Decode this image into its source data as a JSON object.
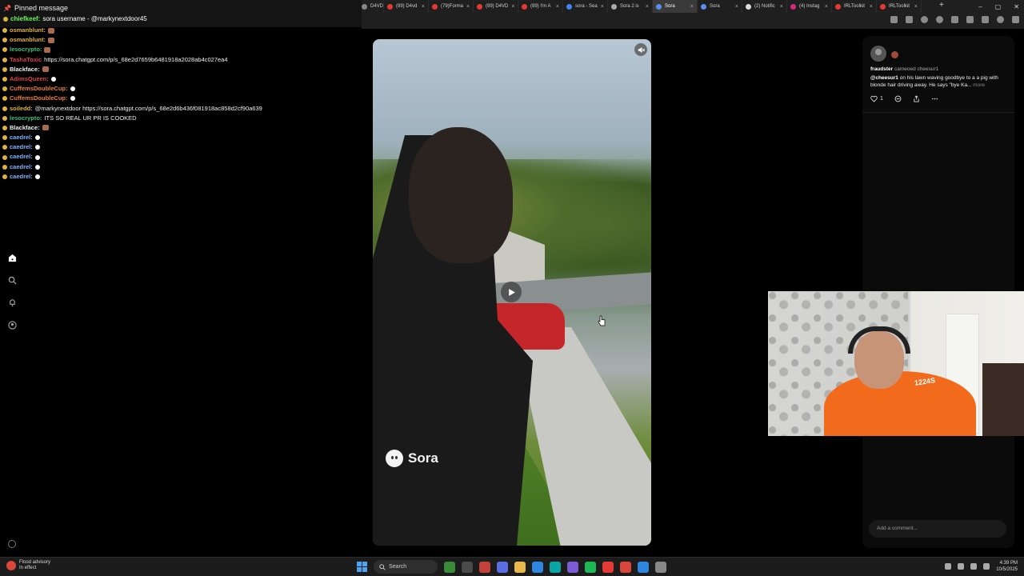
{
  "browser": {
    "tabs": [
      {
        "label": "D4VD",
        "color": "#888888"
      },
      {
        "label": "(89) D4vd",
        "color": "#e53935"
      },
      {
        "label": "(79)Forma",
        "color": "#e53935"
      },
      {
        "label": "(89) D4VD",
        "color": "#e53935"
      },
      {
        "label": "(89) I'm A",
        "color": "#e53935"
      },
      {
        "label": "sora - Sea",
        "color": "#4285f4"
      },
      {
        "label": "Sora 2 is",
        "color": "#aaaaaa"
      },
      {
        "label": "Sora",
        "color": "#5b8def",
        "active": true
      },
      {
        "label": "Sora",
        "color": "#5b8def"
      },
      {
        "label": "(2) Notific",
        "color": "#dddddd"
      },
      {
        "label": "(4) Instag",
        "color": "#d62976"
      },
      {
        "label": "IRLToolkit",
        "color": "#e53935"
      },
      {
        "label": "IRLToolkit",
        "color": "#e53935"
      }
    ],
    "new_tab": "+",
    "window_controls": [
      "–",
      "▢",
      "✕"
    ]
  },
  "chat": {
    "pinned_title": "Pinned message",
    "pinned_user": "chiefkeef:",
    "pinned_text": "sora username - @markynextdoor45",
    "lines": [
      {
        "user": "osmanblunt:",
        "color": "#e0b43a",
        "msg": ""
      },
      {
        "user": "osmanblunt:",
        "color": "#e0b43a",
        "msg": ""
      },
      {
        "user": "lesocrypto:",
        "color": "#3fbf7f",
        "msg": ""
      },
      {
        "user": "TashaToxic",
        "color": "#e0424d",
        "msg": "https://sora.chatgpt.com/p/s_68e2d7659b6481918a2028ab4c027ea4"
      },
      {
        "user": "Blackface:",
        "color": "#f0f0f0",
        "msg": ""
      },
      {
        "user": "AdimsQueen:",
        "color": "#e0424d",
        "msg": ""
      },
      {
        "user": "CuffemsDoubleCup:",
        "color": "#ef7d2c",
        "msg": ""
      },
      {
        "user": "CuffemsDoubleCup:",
        "color": "#ef7d2c",
        "msg": ""
      },
      {
        "user": "soiledd:",
        "color": "#e0b43a",
        "msg": "@markynextdoor https://sora.chatgpt.com/p/s_68e2d6b436f081918ac858d2cf90a639"
      },
      {
        "user": "lesocrypto:",
        "color": "#3fbf7f",
        "msg": "ITS SO REAL UR PR IS COOKED"
      },
      {
        "user": "Blackface:",
        "color": "#f0f0f0",
        "msg": ""
      },
      {
        "user": "caedrel:",
        "color": "#7fb3ff",
        "msg": ""
      },
      {
        "user": "caedrel:",
        "color": "#7fb3ff",
        "msg": ""
      },
      {
        "user": "caedrel:",
        "color": "#7fb3ff",
        "msg": ""
      },
      {
        "user": "caedrel:",
        "color": "#7fb3ff",
        "msg": ""
      },
      {
        "user": "caedrel:",
        "color": "#7fb3ff",
        "msg": ""
      }
    ]
  },
  "sidebar": {
    "icons": [
      "home-icon",
      "search-icon",
      "notifications-icon",
      "profile-icon"
    ]
  },
  "video": {
    "watermark": "Sora"
  },
  "post": {
    "username": "fraudster",
    "cameo_text": "cameoed cheesur1",
    "caption_handle": "@cheesur1",
    "caption_text": "on his lawn waving goodbye to a a pig with blonde hair driving away. He says \"bye Ka...",
    "more_label": "more",
    "like_count": "1",
    "comment_placeholder": "Add a comment..."
  },
  "webcam": {
    "shirt_text": "1224S"
  },
  "taskbar": {
    "weather_title": "Flood advisory",
    "weather_sub": "In effect",
    "search_label": "Search",
    "apps": [
      "#3a8a3a",
      "#4a4a4a",
      "#c2423b",
      "#5b6ee1",
      "#e8b84a",
      "#2e86de",
      "#0aa5a5",
      "#7b5cd6",
      "#1db954",
      "#e53935",
      "#d9463b",
      "#2e86de",
      "#888888"
    ],
    "time": "4:39 PM",
    "date": "10/5/2025"
  }
}
